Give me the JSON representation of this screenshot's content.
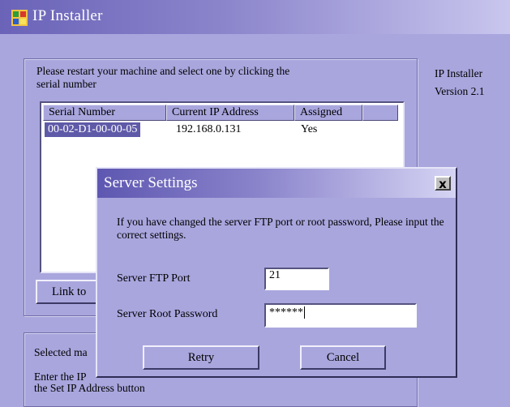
{
  "window": {
    "title": "IP Installer"
  },
  "instructions": "Please restart your machine and select one by clicking the serial number",
  "version_panel": {
    "line1": "IP Installer",
    "line2": "Version 2.1"
  },
  "device_list": {
    "columns": [
      "Serial Number",
      "Current IP Address",
      "Assigned"
    ],
    "rows": [
      {
        "serial": "00-02-D1-00-00-05",
        "ip": "192.168.0.131",
        "assigned": "Yes"
      }
    ]
  },
  "link_button_label": "Link to",
  "selected_group": {
    "label": "Selected ma",
    "text_line1": "Enter the IP",
    "text_line2": "the Set IP Address button"
  },
  "dialog": {
    "title": "Server Settings",
    "message": "If you have changed the server FTP port or root password, Please input the correct settings.",
    "ftp_port_label": "Server FTP Port",
    "ftp_port_value": "21",
    "root_password_label": "Server Root Password",
    "root_password_value": "******",
    "retry_label": "Retry",
    "cancel_label": "Cancel",
    "close_label": "x"
  }
}
